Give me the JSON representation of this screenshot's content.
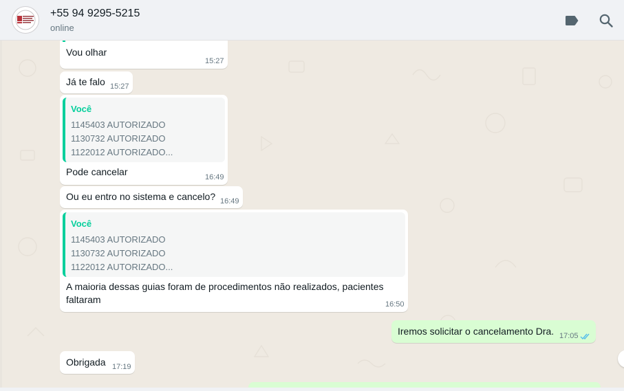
{
  "header": {
    "contact_name": "+55 94 9295-5215",
    "status": "online",
    "icons": [
      "label-icon",
      "search-icon"
    ]
  },
  "colors": {
    "header_bg": "#f0f2f5",
    "chat_bg": "#efeae2",
    "incoming_bubble": "#ffffff",
    "outgoing_bubble": "#d9fdd3",
    "quote_accent": "#06cf9c",
    "read_ticks": "#53bdeb"
  },
  "messages": [
    {
      "direction": "in",
      "text": "Vou olhar",
      "time": "15:27"
    },
    {
      "direction": "in",
      "text": "Já te falo",
      "time": "15:27"
    },
    {
      "direction": "in",
      "quote": {
        "author": "Você",
        "lines": [
          "1145403 AUTORIZADO",
          "1130732 AUTORIZADO",
          "1122012 AUTORIZADO..."
        ]
      },
      "text": "Pode cancelar",
      "time": "16:49"
    },
    {
      "direction": "in",
      "text": "Ou eu entro no sistema e cancelo?",
      "time": "16:49"
    },
    {
      "direction": "in",
      "quote": {
        "author": "Você",
        "lines": [
          "1145403 AUTORIZADO",
          "1130732 AUTORIZADO",
          "1122012 AUTORIZADO..."
        ]
      },
      "text": "A maioria dessas guias foram de procedimentos não realizados, pacientes faltaram",
      "time": "16:50"
    },
    {
      "direction": "out",
      "text": "Iremos solicitar o cancelamento Dra.",
      "time": "17:05",
      "status": "read"
    },
    {
      "direction": "in",
      "text": "Obrigada",
      "time": "17:19"
    }
  ]
}
